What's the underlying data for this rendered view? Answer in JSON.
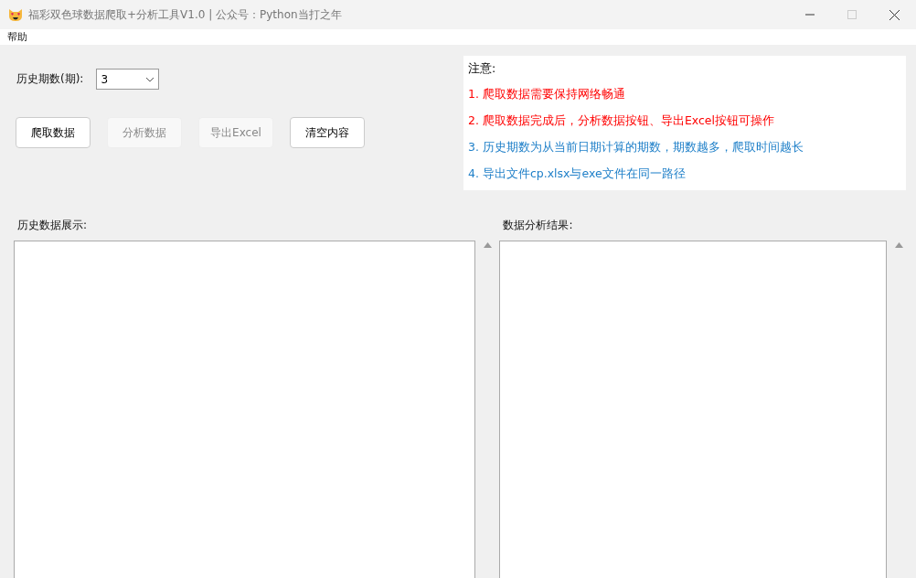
{
  "window": {
    "title": "福彩双色球数据爬取+分析工具V1.0 | 公众号：Python当打之年"
  },
  "menu": [
    {
      "label": "帮助"
    }
  ],
  "period": {
    "label": "历史期数(期):",
    "value": "3"
  },
  "buttons": [
    {
      "label": "爬取数据",
      "disabled": false
    },
    {
      "label": "分析数据",
      "disabled": true
    },
    {
      "label": "导出Excel",
      "disabled": true
    },
    {
      "label": "清空内容",
      "disabled": false
    }
  ],
  "notice": {
    "title": "注意:",
    "items": [
      {
        "text": "1. 爬取数据需要保持网络畅通",
        "color": "#ff0000"
      },
      {
        "text": "2. 爬取数据完成后，分析数据按钮、导出Excel按钮可操作",
        "color": "#ff0000"
      },
      {
        "text": "3. 历史期数为从当前日期计算的期数，期数越多，爬取时间越长",
        "color": "#1e7fc8"
      },
      {
        "text": "4. 导出文件cp.xlsx与exe文件在同一路径",
        "color": "#1e7fc8"
      }
    ]
  },
  "panels": [
    {
      "label": "历史数据展示:"
    },
    {
      "label": "数据分析结果:"
    }
  ]
}
